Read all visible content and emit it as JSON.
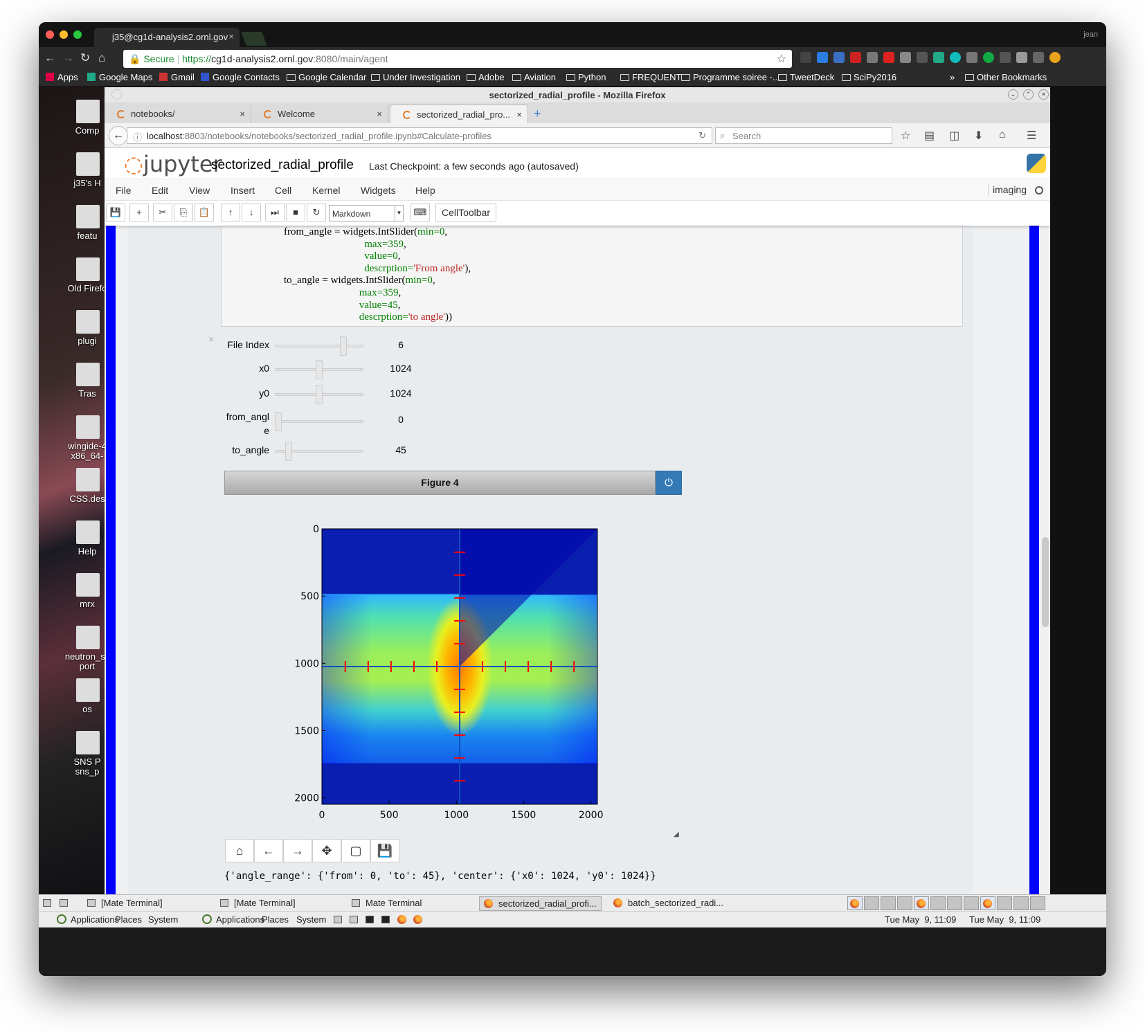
{
  "chrome": {
    "tab_title": "j35@cg1d-analysis2.ornl.gov",
    "tab_close": "×",
    "user": "jean",
    "secure": "Secure",
    "url_prefix": "https://",
    "url_host": "cg1d-analysis2.ornl.gov",
    "url_rest": ":8080/main/agent",
    "bookmarks": [
      "Apps",
      "Google Maps",
      "Gmail",
      "Google Contacts",
      "Google Calendar",
      "Under Investigation",
      "Adobe",
      "Aviation",
      "Python",
      "FREQUENT",
      "Programme soiree -...",
      "TweetDeck",
      "SciPy2016"
    ],
    "bookmarks_more": "»",
    "other_bookmarks": "Other Bookmarks"
  },
  "desktop": {
    "icons": [
      "Comp",
      "j35's H",
      "featu",
      "Old Firefo",
      "plugi",
      "Tras",
      "wingide-4\nx86_64-",
      "CSS.des",
      "Help",
      "mrx",
      "neutron_sc\nport",
      "os",
      "SNS P\nsns_p"
    ]
  },
  "firefox": {
    "window_title": "sectorized_radial_profile - Mozilla Firefox",
    "tabs": [
      {
        "label": "notebooks/"
      },
      {
        "label": "Welcome"
      },
      {
        "label": "sectorized_radial_pro..."
      }
    ],
    "tab_plus": "+",
    "url_host": "localhost",
    "url_rest": ":8803/notebooks/notebooks/sectorized_radial_profile.ipynb#Calculate-profiles",
    "search_placeholder": "Search"
  },
  "jupyter": {
    "logo": "jupyter",
    "notebook_name": "sectorized_radial_profile",
    "checkpoint": "Last Checkpoint: a few seconds ago (autosaved)",
    "menu": [
      "File",
      "Edit",
      "View",
      "Insert",
      "Cell",
      "Kernel",
      "Widgets",
      "Help"
    ],
    "kernel": "imaging",
    "cell_type": "Markdown",
    "celltoolbar": "CellToolbar"
  },
  "code_lines": [
    [
      "from_angle = widgets.IntSlider(",
      "min=",
      "0",
      ","
    ],
    [
      "                               ",
      "max=",
      "359",
      ","
    ],
    [
      "                               ",
      "value=",
      "0",
      ","
    ],
    [
      "                               ",
      "descrption=",
      "'From angle'",
      "),"
    ],
    [
      "to_angle = widgets.IntSlider(",
      "min=",
      "0",
      ","
    ],
    [
      "                             ",
      "max=",
      "359",
      ","
    ],
    [
      "                             ",
      "value=",
      "45",
      ","
    ],
    [
      "                             ",
      "descrption=",
      "'to angle'",
      "))"
    ]
  ],
  "widgets": [
    {
      "label": "File Index",
      "value": "6",
      "level": 0.8
    },
    {
      "label": "x0",
      "value": "1024",
      "level": 0.5
    },
    {
      "label": "y0",
      "value": "1024",
      "level": 0.5
    },
    {
      "label": "from_angl\ne",
      "value": "0",
      "level": 0.0
    },
    {
      "label": "to_angle",
      "value": "45",
      "level": 0.125
    }
  ],
  "widget_close": "×",
  "figure": {
    "title": "Figure 4",
    "power": "⏻"
  },
  "chart_data": {
    "type": "heatmap",
    "title": "",
    "xlabel": "",
    "ylabel": "",
    "xlim": [
      0,
      2048
    ],
    "ylim": [
      2048,
      0
    ],
    "x_ticks": [
      0,
      500,
      1000,
      1500,
      2000
    ],
    "y_ticks": [
      0,
      500,
      1000,
      1500,
      2000
    ],
    "x_tick_labels": [
      "0",
      "500",
      "1000",
      "1500",
      "2000"
    ],
    "y_tick_labels": [
      "0",
      "500",
      "1000",
      "1500",
      "2000"
    ],
    "center": {
      "x0": 1024,
      "y0": 1024
    },
    "bright_rows": [
      490,
      1750
    ],
    "sector_angles": [
      0,
      45
    ],
    "colormap": "jet",
    "marker_color": "#ff0000"
  },
  "nav_buttons": [
    "home",
    "back",
    "forward",
    "pan",
    "zoom",
    "save"
  ],
  "output": "{'angle_range': {'from': 0, 'to': 45}, 'center': {'x0': 1024, 'y0': 1024}}",
  "panel": {
    "tasks_top": [
      "[Mate Terminal]",
      "[Mate Terminal]",
      "Mate Terminal",
      "sectorized_radial_profi...",
      "batch_sectorized_radi..."
    ],
    "menus_bottom": [
      "Applications",
      "Places",
      "System",
      "Applications",
      "Places",
      "System"
    ],
    "clock1": "Tue May  9, 11:09",
    "clock2": "Tue May  9, 11:09"
  }
}
